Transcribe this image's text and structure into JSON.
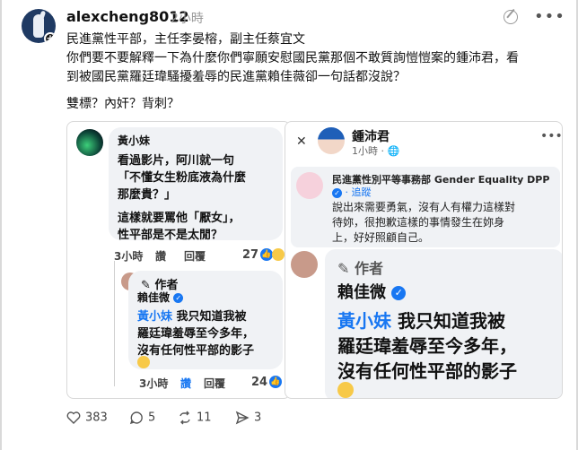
{
  "post": {
    "username": "alexcheng8012",
    "time": "2小時",
    "lines": [
      "民進黨性平部，主任李晏榕，副主任蔡宜文",
      "你們要不要解釋一下為什麼你們寧願安慰國民黨那個不敢質詢愷愷案的鍾沛君，看",
      "到被國民黨羅廷瑋騷擾羞辱的民進黨賴佳薇卻一句話都沒說？",
      "雙標？內奸？背刺？"
    ]
  },
  "left_card": {
    "comment_name": "黃小妹",
    "comment_lines": [
      "看過影片，阿川就一句",
      "「不懂女生粉底液為什麼",
      "那麼貴？」",
      "這樣就要罵他「厭女」，",
      "性平部是不是太閒？"
    ],
    "comment_meta": {
      "time": "3小時",
      "like": "讚",
      "reply": "回覆",
      "count": "27"
    },
    "reply_author_tag": "作者",
    "reply_name": "賴佳微",
    "reply_mention": "黃小妹",
    "reply_lines": [
      "我只知道我被",
      "羅廷瑋羞辱至今多年，",
      "沒有任何性平部的影子"
    ],
    "reply_meta": {
      "time": "3小時",
      "like": "讚",
      "reply": "回覆",
      "count": "24"
    }
  },
  "right_card": {
    "name": "鍾沛君",
    "time": "1小時",
    "notice_name": "民進黨性別平等事務部 Gender Equality DPP",
    "notice_follow": "· 追蹤",
    "notice_lines": [
      "說出來需要勇氣，沒有人有權力這樣對",
      "待妳，很抱歉這樣的事情發生在妳身",
      "上，好好照顧自己。"
    ],
    "author_tag": "作者",
    "reply_name": "賴佳微",
    "reply_mention": "黃小妹",
    "reply_lines": [
      "我只知道我被",
      "羅廷瑋羞辱至今多年，",
      "沒有任何性平部的影子"
    ]
  },
  "actions": {
    "likes": "383",
    "comments": "5",
    "reposts": "11",
    "shares": "3"
  }
}
